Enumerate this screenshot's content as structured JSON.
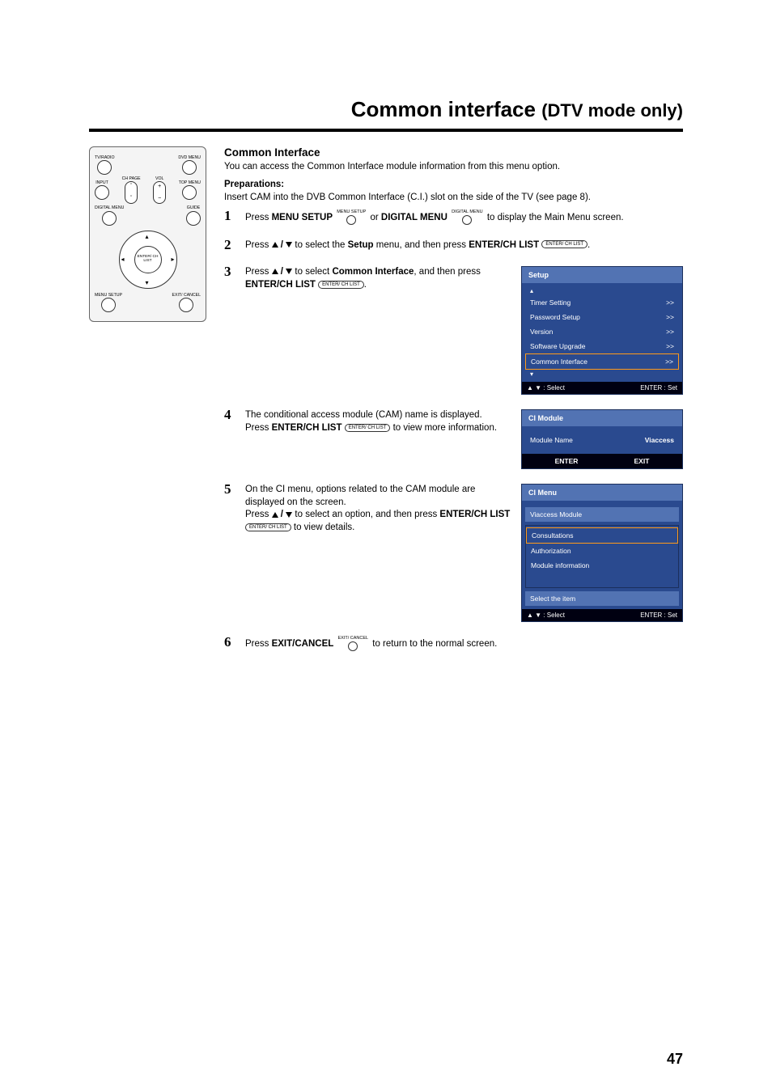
{
  "page": {
    "title_main": "Common interface",
    "title_sub": "(DTV mode only)",
    "number": "47"
  },
  "section": {
    "title": "Common Interface"
  },
  "intro": "You can access the Common Interface module information from this menu option.",
  "prep": {
    "label": "Preparations:",
    "text": "Insert CAM into the DVB Common Interface (C.I.) slot on the side of the TV (see page 8)."
  },
  "icons": {
    "up": "▲",
    "down": "▼",
    "enter_chip": "ENTER/ CH LIST",
    "menu_setup_tag": "MENU SETUP",
    "digital_menu_tag": "DIGITAL MENU",
    "exit_cancel_tag": "EXIT/ CANCEL"
  },
  "steps": [
    {
      "pre": "Press ",
      "b1": "MENU SETUP",
      "mid": " or ",
      "b2": "DIGITAL MENU",
      "post": " to display the Main Menu screen."
    },
    {
      "pre": "Press ",
      "mid": " to select the ",
      "b1": "Setup",
      "post": " menu, and then press ",
      "b2": "ENTER/CH LIST",
      "dot": "."
    },
    {
      "pre": "Press ",
      "mid": " to select ",
      "b1": "Common Interface",
      "post": ", and then press ",
      "b2": "ENTER/CH LIST",
      "dot": "."
    },
    {
      "l1": "The conditional access module (CAM) name is displayed.",
      "l2a": "Press ",
      "b1": "ENTER/CH LIST",
      "l2b": " to view more information."
    },
    {
      "l1": "On the CI menu, options related to the CAM module are displayed on the screen.",
      "l2a": "Press ",
      "mid": " to select an option, and then press ",
      "b1": "ENTER/CH LIST",
      "l2b": " to view details."
    },
    {
      "pre": "Press ",
      "b1": "EXIT/CANCEL",
      "post": " to return to the normal screen."
    }
  ],
  "osd_setup": {
    "title": "Setup",
    "items": [
      {
        "label": "Timer Setting",
        "val": ">>",
        "sel": false
      },
      {
        "label": "Password Setup",
        "val": ">>",
        "sel": false
      },
      {
        "label": "Version",
        "val": ">>",
        "sel": false
      },
      {
        "label": "Software Upgrade",
        "val": ">>",
        "sel": false
      },
      {
        "label": "Common Interface",
        "val": ">>",
        "sel": true
      }
    ],
    "foot_left": "▲ ▼ : Select",
    "foot_right": "ENTER : Set"
  },
  "osd_cimod": {
    "title": "CI Module",
    "name_label": "Module Name",
    "name_value": "Viaccess",
    "foot_enter": "ENTER",
    "foot_exit": "EXIT"
  },
  "osd_cimenu": {
    "title": "CI Menu",
    "module": "Viaccess Module",
    "items": [
      "Consultations",
      "Authorization",
      "Module information"
    ],
    "hint": "Select the item",
    "foot_left": "▲ ▼ : Select",
    "foot_right": "ENTER : Set"
  },
  "remote": {
    "tvradio": "TV/RADIO",
    "dvdmenu": "DVD MENU",
    "input": "INPUT",
    "chpage": "CH PAGE",
    "vol": "VOL",
    "topmenu": "TOP MENU",
    "digital": "DIGITAL MENU",
    "guide": "GUIDE",
    "center": "ENTER/ CH LIST",
    "menusetup": "MENU SETUP",
    "exitcancel": "EXIT/ CANCEL"
  }
}
